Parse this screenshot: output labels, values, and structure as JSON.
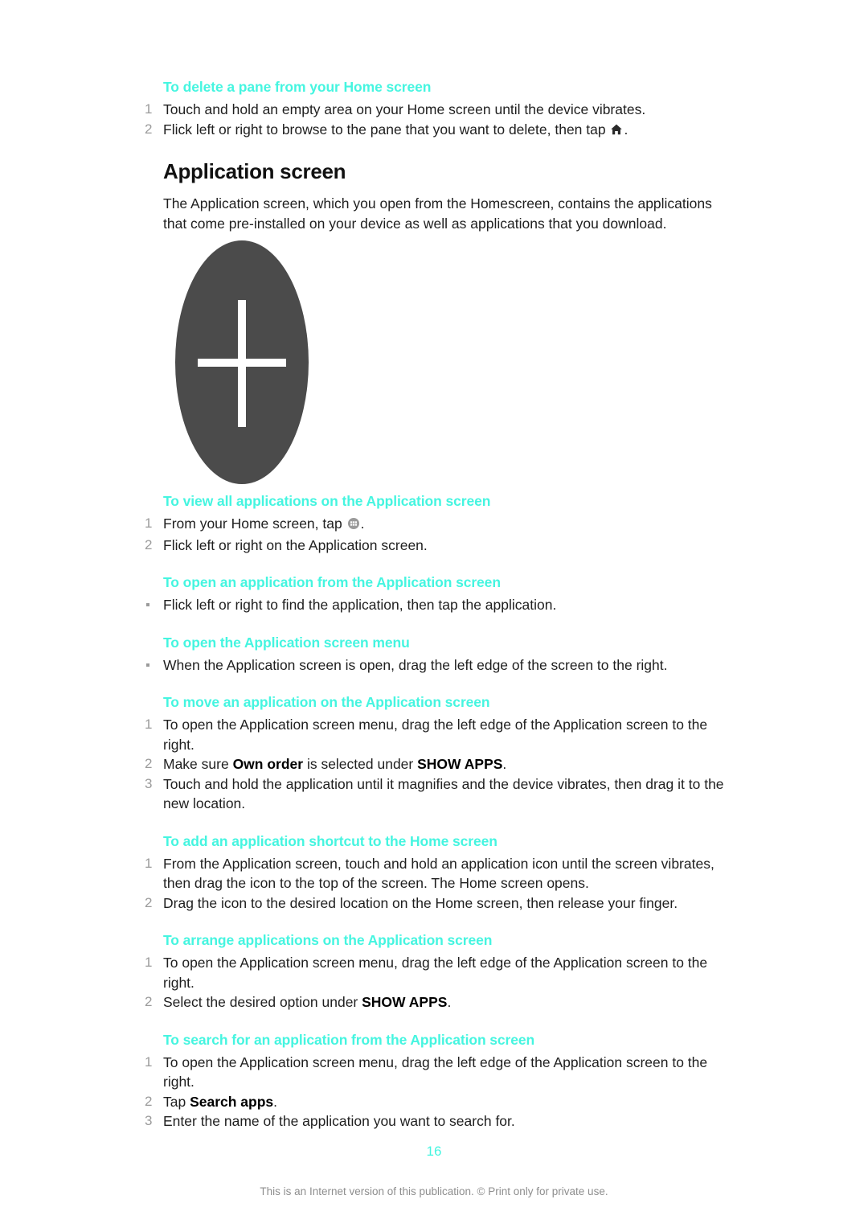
{
  "document": {
    "page_number": "16",
    "footer_note": "This is an Internet version of this publication. © Print only for private use.",
    "accent_color": "#45f5e0",
    "text_color": "#1f1f1f",
    "marker_color": "#9b9b9b"
  },
  "sections": {
    "delete_pane": {
      "heading": "To delete a pane from your Home screen",
      "steps": [
        {
          "marker": "1",
          "text": "Touch and hold an empty area on your Home screen until the device vibrates."
        },
        {
          "marker": "2",
          "text_before": "Flick left or right to browse to the pane that you want to delete, then tap ",
          "icon": "home-icon",
          "text_after": "."
        }
      ]
    },
    "application_screen": {
      "title": "Application screen",
      "paragraph": "The Application screen, which you open from the Homescreen, contains the applications that come pre-installed on your device as well as applications that you download.",
      "illustration": {
        "name": "application-screen-illustration",
        "shape": "ellipse-with-cross",
        "fill_color": "#4b4b4b",
        "cross_color": "#ffffff"
      }
    },
    "view_all_applications": {
      "heading": "To view all applications on the Application screen",
      "steps": [
        {
          "marker": "1",
          "text_before": "From your Home screen, tap ",
          "icon": "apps-grid-icon",
          "text_after": "."
        },
        {
          "marker": "2",
          "text": "Flick left or right on the Application screen."
        }
      ]
    },
    "open_application": {
      "heading": "To open an application from the Application screen",
      "steps": [
        {
          "marker": "•",
          "text": "Flick left or right to find the application, then tap the application."
        }
      ]
    },
    "open_menu": {
      "heading": "To open the Application screen menu",
      "steps": [
        {
          "marker": "•",
          "text": "When the Application screen is open, drag the left edge of the screen to the right."
        }
      ]
    },
    "move_application": {
      "heading": "To move an application on the Application screen",
      "steps": [
        {
          "marker": "1",
          "text": "To open the Application screen menu, drag the left edge of the Application screen to the right."
        },
        {
          "marker": "2",
          "text_before": "Make sure ",
          "bold1": "Own order",
          "text_mid": " is selected under ",
          "bold2": "SHOW APPS",
          "text_after": "."
        },
        {
          "marker": "3",
          "text": "Touch and hold the application until it magnifies and the device vibrates, then drag it to the new location."
        }
      ]
    },
    "add_shortcut": {
      "heading": "To add an application shortcut to the Home screen",
      "steps": [
        {
          "marker": "1",
          "text": "From the Application screen, touch and hold an application icon until the screen vibrates, then drag the icon to the top of the screen. The Home screen opens."
        },
        {
          "marker": "2",
          "text": "Drag the icon to the desired location on the Home screen, then release your finger."
        }
      ]
    },
    "arrange_applications": {
      "heading": "To arrange applications on the Application screen",
      "steps": [
        {
          "marker": "1",
          "text": "To open the Application screen menu, drag the left edge of the Application screen to the right."
        },
        {
          "marker": "2",
          "text_before": "Select the desired option under ",
          "bold1": "SHOW APPS",
          "text_after": "."
        }
      ]
    },
    "search_application": {
      "heading": "To search for an application from the Application screen",
      "steps": [
        {
          "marker": "1",
          "text": "To open the Application screen menu, drag the left edge of the Application screen to the right."
        },
        {
          "marker": "2",
          "text_before": "Tap ",
          "bold1": "Search apps",
          "text_after": "."
        },
        {
          "marker": "3",
          "text": "Enter the name of the application you want to search for."
        }
      ]
    }
  }
}
